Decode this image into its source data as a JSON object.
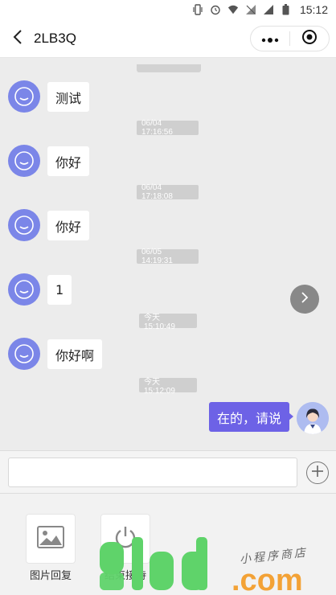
{
  "status_bar": {
    "time": "15:12",
    "icons": [
      "vibrate-icon",
      "alarm-icon",
      "wifi-icon",
      "signal-icon",
      "signal-off-icon",
      "battery-icon"
    ]
  },
  "nav": {
    "title": "2LB3Q",
    "back_icon": "chevron-left-icon",
    "more_icon": "more-dots-icon",
    "close_icon": "target-circle-icon"
  },
  "messages": [
    {
      "type": "incoming",
      "text": "测试"
    },
    {
      "type": "timestamp",
      "text": "06/04 17:16:56"
    },
    {
      "type": "incoming",
      "text": "你好"
    },
    {
      "type": "timestamp",
      "text": "06/04 17:18:08"
    },
    {
      "type": "incoming",
      "text": "你好"
    },
    {
      "type": "timestamp",
      "text": "06/05 14:19:31"
    },
    {
      "type": "incoming",
      "text": "1"
    },
    {
      "type": "timestamp",
      "text": "今天 15:10:49"
    },
    {
      "type": "incoming",
      "text": "你好啊"
    },
    {
      "type": "timestamp",
      "text": "今天 15:12:09"
    },
    {
      "type": "outgoing",
      "text": "在的，请说"
    }
  ],
  "input": {
    "value": "",
    "placeholder": ""
  },
  "tools": [
    {
      "label": "图片回复",
      "icon": "image-icon"
    },
    {
      "label": "结束接待",
      "icon": "power-icon"
    }
  ],
  "watermark": {
    "brand": "9iud",
    "domain": ".com",
    "tagline": "小程序商店"
  },
  "colors": {
    "outgoing_bubble": "#6d62e6",
    "incoming_avatar": "#7b86e8",
    "timestamp_bg": "#cfcfcf",
    "watermark_green": "#5fd36a",
    "watermark_orange": "#f3a236"
  }
}
